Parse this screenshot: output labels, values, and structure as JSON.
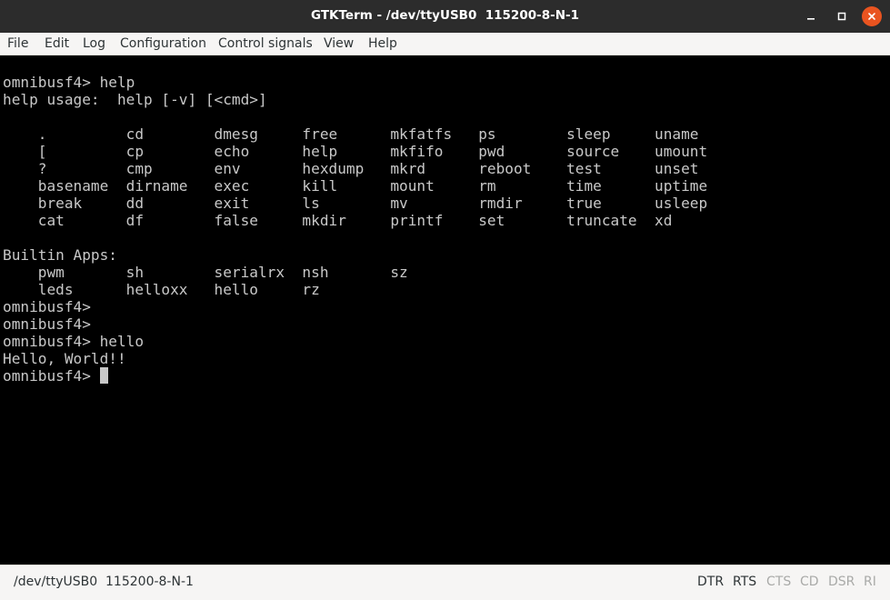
{
  "window": {
    "title": "GTKTerm - /dev/ttyUSB0  115200-8-N-1"
  },
  "menu": {
    "file": "File",
    "edit": "Edit",
    "log": "Log",
    "configuration": "Configuration",
    "control_signals": "Control signals",
    "view": "View",
    "help": "Help"
  },
  "terminal": {
    "output": "omnibusf4> help\nhelp usage:  help [-v] [<cmd>]\n\n    .         cd        dmesg     free      mkfatfs   ps        sleep     uname\n    [         cp        echo      help      mkfifo    pwd       source    umount\n    ?         cmp       env       hexdump   mkrd      reboot    test      unset\n    basename  dirname   exec      kill      mount     rm        time      uptime\n    break     dd        exit      ls        mv        rmdir     true      usleep\n    cat       df        false     mkdir     printf    set       truncate  xd\n\nBuiltin Apps:\n    pwm       sh        serialrx  nsh       sz\n    leds      helloxx   hello     rz\nomnibusf4>\nomnibusf4>\nomnibusf4> hello\nHello, World!!\n",
    "prompt": "omnibusf4> "
  },
  "status": {
    "port": "/dev/ttyUSB0  115200-8-N-1",
    "signals": {
      "dtr": "DTR",
      "rts": "RTS",
      "cts": "CTS",
      "cd": "CD",
      "dsr": "DSR",
      "ri": "RI"
    }
  },
  "colors": {
    "terminal_bg": "#000000",
    "terminal_fg": "#c8c8c8",
    "close_button": "#e95420",
    "signal_active": "#2e3436",
    "signal_inactive": "#a9aaa8"
  }
}
